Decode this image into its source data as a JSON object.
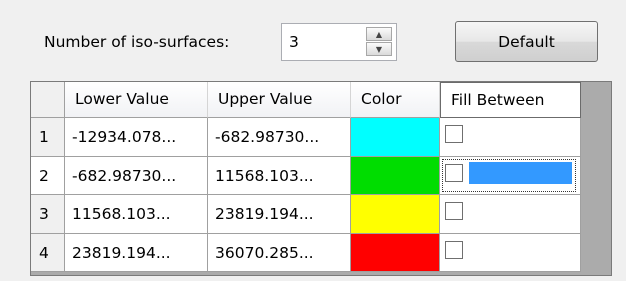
{
  "controls": {
    "iso_label": "Number of iso-surfaces:",
    "iso_count": "3",
    "default_label": "Default"
  },
  "grid": {
    "headers": [
      "Lower Value",
      "Upper Value",
      "Color",
      "Fill Between"
    ],
    "rows": [
      {
        "num": "1",
        "lower": "-12934.078...",
        "upper": "-682.98730...",
        "color": "#00ffff",
        "fill": false
      },
      {
        "num": "2",
        "lower": "-682.98730...",
        "upper": "11568.103...",
        "color": "#00dd00",
        "fill": false
      },
      {
        "num": "3",
        "lower": "11568.103...",
        "upper": "23819.194...",
        "color": "#ffff00",
        "fill": false
      },
      {
        "num": "4",
        "lower": "23819.194...",
        "upper": "36070.285...",
        "color": "#ff0000",
        "fill": false
      }
    ],
    "selection_color": "#3399ff"
  }
}
